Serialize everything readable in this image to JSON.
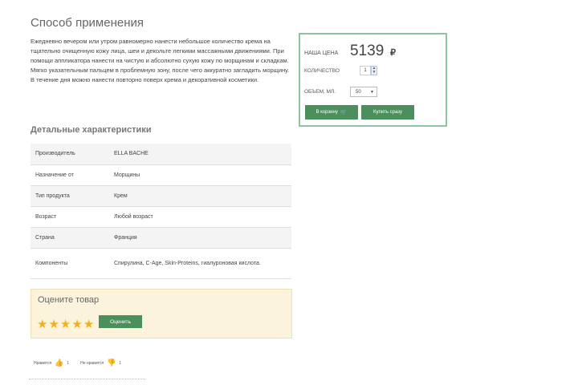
{
  "usage": {
    "title": "Способ применения",
    "text": "Ежедневно вечером или утром равномерно нанести небольшое количество крема на тщательно очищенную кожу лица, шеи и декольте легкими массажными движениями. При помощи аппликатора нанести на чистую и абсолютно сухую кожу по морщинам и складкам. Мягко указательным пальцем в проблемную зону, после чего аккуратно загладить морщину. В течение дня можно нанести повторно поверх крема и декоративной косметики."
  },
  "specs": {
    "title": "Детальные характеристики",
    "rows": [
      {
        "key": "Производитель",
        "value": "ELLA BACHE"
      },
      {
        "key": "Назначение от",
        "value": "Морщины"
      },
      {
        "key": "Тип продукта",
        "value": "Крем"
      },
      {
        "key": "Возраст",
        "value": "Любой возраст"
      },
      {
        "key": "Страна",
        "value": "Франция"
      },
      {
        "key": "Компоненты",
        "value": "Спирулина, C-Age, Skin-Proteins, гиалуроновая кислота."
      }
    ]
  },
  "rating": {
    "title": "Оцените товар",
    "stars_selected": 5,
    "stars_total": 5,
    "button_label": "Оценить"
  },
  "votes": {
    "like_label": "Нравится",
    "like_count": "1",
    "dislike_label": "Не нравится",
    "dislike_count": "1"
  },
  "purchase": {
    "price_label": "НАША ЦЕНА",
    "price_value": "5139",
    "currency": "₽",
    "qty_label": "КОЛИЧЕСТВО",
    "qty_value": "1",
    "volume_label": "ОБЪЕМ, МЛ.",
    "volume_selected": "50",
    "cart_button": "В корзину",
    "buy_button": "Купить сразу"
  },
  "icons": {
    "star": "star-icon",
    "like": "thumbs-up-icon",
    "dislike": "thumbs-down-icon",
    "cart": "cart-icon"
  },
  "colors": {
    "accent_green": "#4a8f5c",
    "star": "#f2b01e",
    "rating_bg": "#fcf3dc",
    "buy_border": "#8ec3a1"
  }
}
